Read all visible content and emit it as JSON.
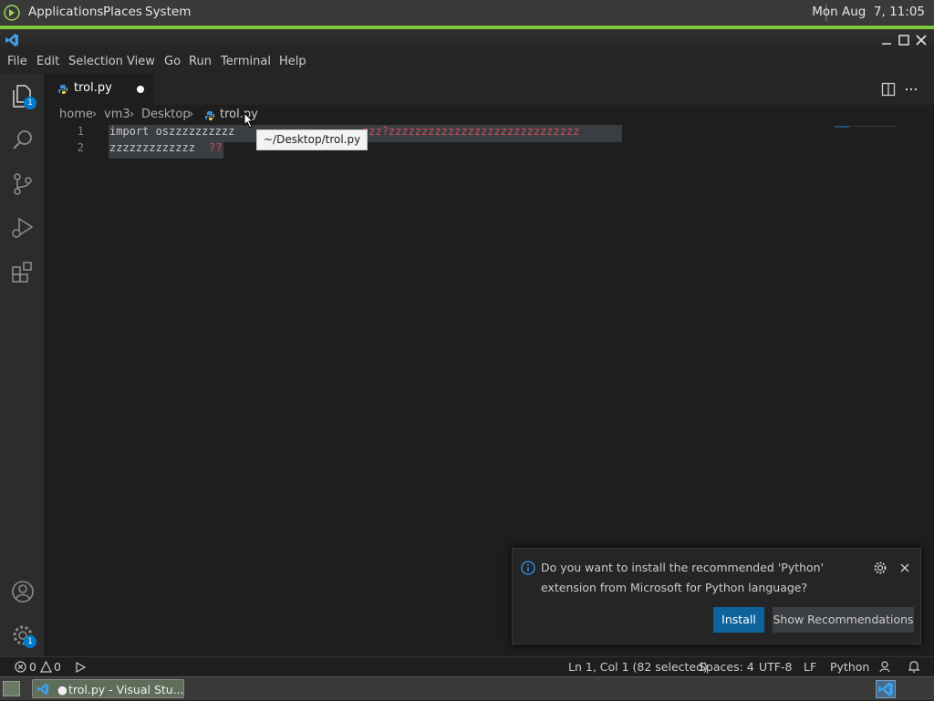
{
  "os_panel": {
    "menus": [
      "Applications",
      "Places",
      "System"
    ],
    "clock": "Mon Aug  7, 11:05"
  },
  "menubar": [
    "File",
    "Edit",
    "Selection",
    "View",
    "Go",
    "Run",
    "Terminal",
    "Help"
  ],
  "activity_badges": {
    "explorer": "1",
    "manage": "1"
  },
  "tab": {
    "name": "trol.py"
  },
  "breadcrumb": [
    "home",
    "vm3",
    "Desktop",
    "trol.py"
  ],
  "editor": {
    "lines": [
      {
        "num": "1",
        "seg1": "import oszzzzzzzzzz",
        "seg2": "zzz?zzzzzzzzzzzzzzzzzzzzzzzzzzzzz"
      },
      {
        "num": "2",
        "seg1": "zzzzzzzzzzzzz",
        "seg2": "??"
      }
    ],
    "tooltip": "~/Desktop/trol.py"
  },
  "notification": {
    "message": "Do you want to install the recommended 'Python' extension from Microsoft for Python language?",
    "install_label": "Install",
    "show_label": "Show Recommendations"
  },
  "statusbar": {
    "errors": "0",
    "warnings": "0",
    "position": "Ln 1, Col 1 (82 selected)",
    "spaces": "Spaces: 4",
    "encoding": "UTF-8",
    "eol": "LF",
    "language": "Python"
  },
  "taskbar": {
    "item": "trol.py - Visual Stu..."
  },
  "colors": {
    "accent": "#007acc",
    "os_green": "#7ec63f",
    "string_red": "#ce4f5e"
  }
}
